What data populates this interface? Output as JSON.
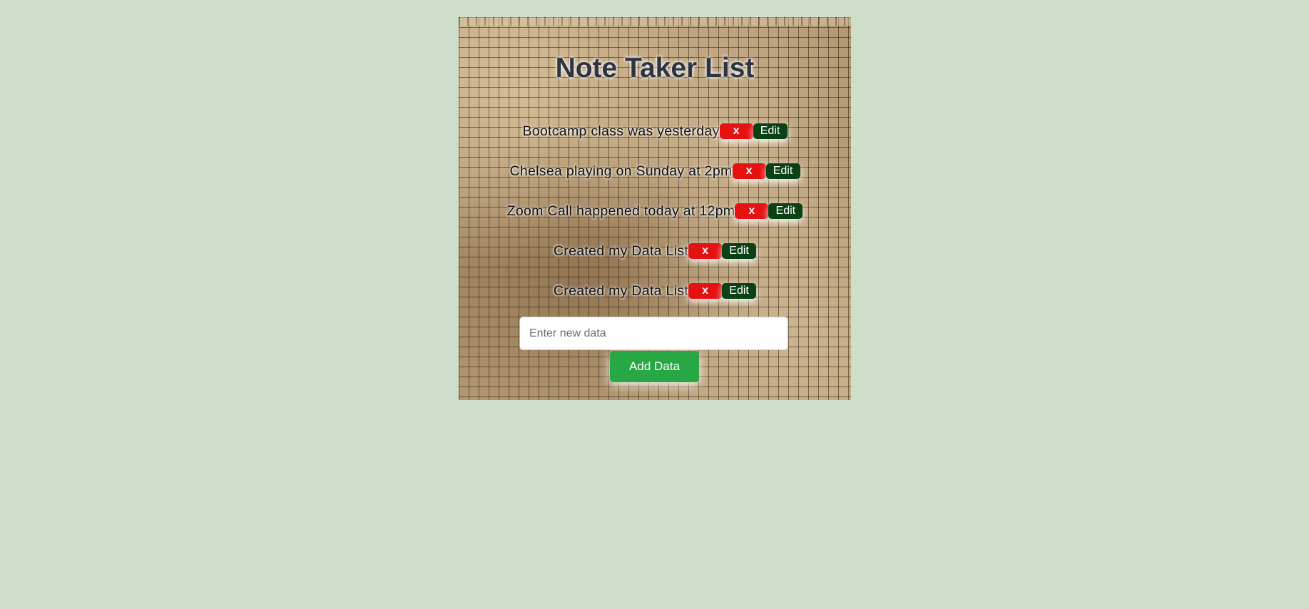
{
  "app": {
    "title": "Note Taker List"
  },
  "notes": [
    {
      "text": "Bootcamp class was yesterday",
      "delete_label": "x",
      "edit_label": "Edit"
    },
    {
      "text": "Chelsea playing on Sunday at 2pm",
      "delete_label": "x",
      "edit_label": "Edit"
    },
    {
      "text": "Zoom Call happened today at 12pm",
      "delete_label": "x",
      "edit_label": "Edit"
    },
    {
      "text": "Created my Data List",
      "delete_label": "x",
      "edit_label": "Edit"
    },
    {
      "text": "Created my Data List",
      "delete_label": "x",
      "edit_label": "Edit"
    }
  ],
  "form": {
    "input_value": "",
    "input_placeholder": "Enter new data",
    "add_label": "Add Data"
  },
  "colors": {
    "page_background": "#cfdec8",
    "delete_button": "#e51212",
    "edit_button": "#0a4216",
    "add_button": "#28a745",
    "title_text": "#2f3540"
  }
}
